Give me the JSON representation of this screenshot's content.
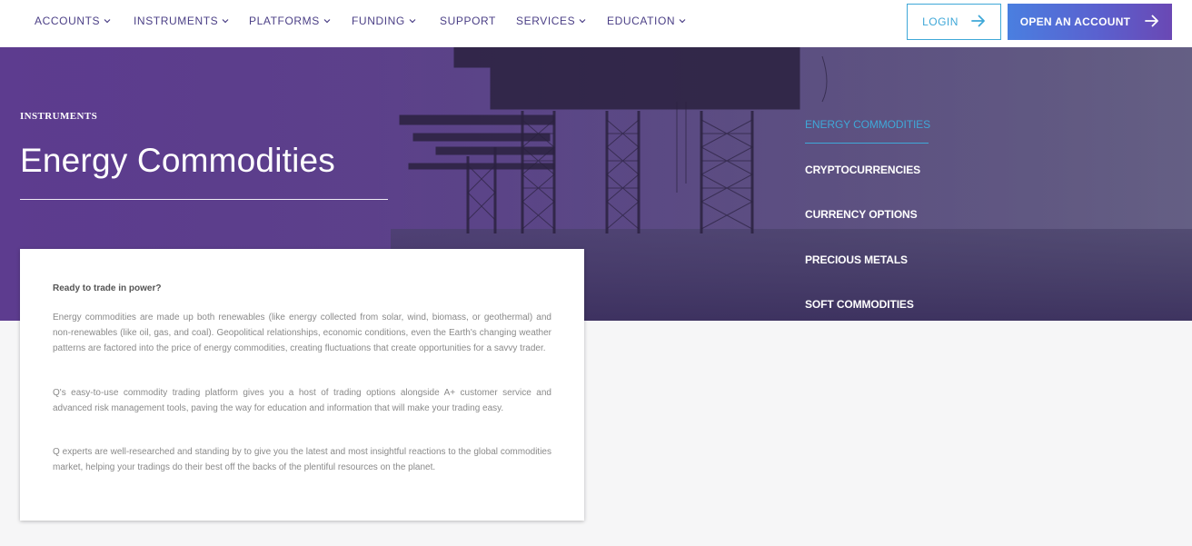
{
  "nav": {
    "items": [
      {
        "label": "ACCOUNTS",
        "has_dropdown": true
      },
      {
        "label": "INSTRUMENTS",
        "has_dropdown": true
      },
      {
        "label": "PLATFORMS",
        "has_dropdown": true
      },
      {
        "label": "FUNDING",
        "has_dropdown": true
      },
      {
        "label": "SUPPORT",
        "has_dropdown": false
      },
      {
        "label": "SERVICES",
        "has_dropdown": true
      },
      {
        "label": "EDUCATION",
        "has_dropdown": true
      }
    ],
    "login_label": "LOGIN",
    "open_account_label": "OPEN AN ACCOUNT"
  },
  "hero": {
    "kicker": "INSTRUMENTS",
    "title": "Energy Commodities"
  },
  "side_menu": {
    "items": [
      {
        "label": "ENERGY COMMODITIES",
        "active": true
      },
      {
        "label": "CRYPTOCURRENCIES",
        "active": false
      },
      {
        "label": "CURRENCY OPTIONS",
        "active": false
      },
      {
        "label": "PRECIOUS METALS",
        "active": false
      },
      {
        "label": "SOFT COMMODITIES",
        "active": false
      }
    ]
  },
  "card": {
    "heading": "Ready to trade in power?",
    "paragraphs": [
      "Energy commodities are made up both renewables (like energy collected from solar, wind, biomass, or geothermal) and non-renewables (like oil, gas, and coal). Geopolitical relationships, economic conditions, even the Earth's changing weather patterns are factored into the price of energy commodities, creating fluctuations that create opportunities for a savvy trader.",
      "Q's easy-to-use commodity trading platform gives you a host of trading options alongside A+ customer service and advanced risk management tools, paving the way for education and information that will make your trading easy.",
      "Q experts are well-researched and standing by to give you the latest and most insightful reactions to the global commodities market, helping your tradings do their best off the backs of the plentiful resources on the planet."
    ]
  },
  "colors": {
    "nav_text": "#4b3f86",
    "accent_blue": "#3fa8d8",
    "hero_purple": "#5d3c8f",
    "button_gradient_start": "#4a7fe0",
    "button_gradient_end": "#6a48b4"
  },
  "icons": {
    "dropdown": "chevron-down-icon",
    "arrow": "arrow-right-icon"
  }
}
